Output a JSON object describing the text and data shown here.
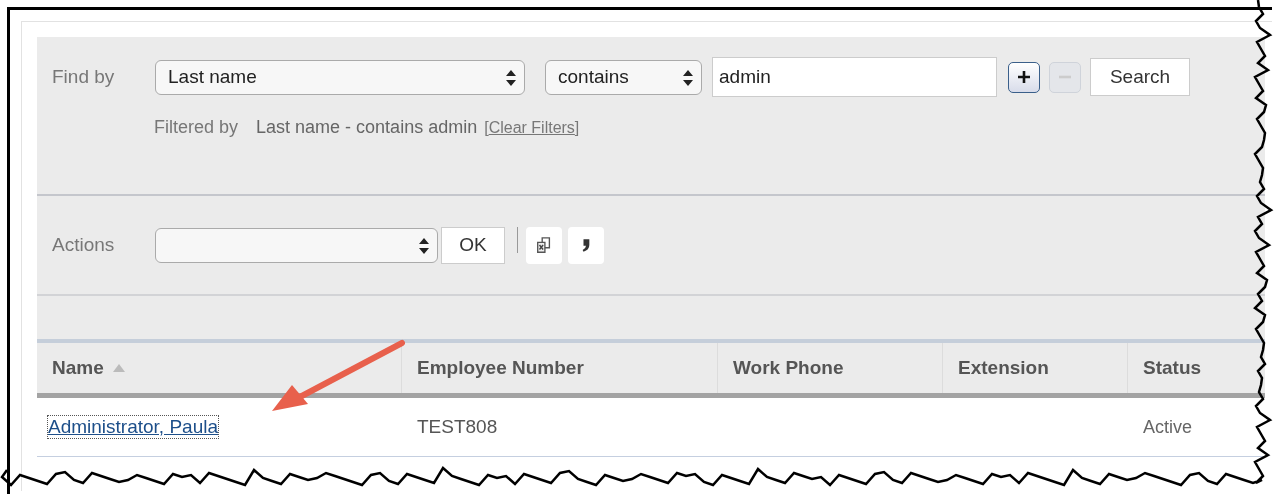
{
  "search": {
    "label": "Find by",
    "field_select": {
      "value": "Last name"
    },
    "operator_select": {
      "value": "contains"
    },
    "query": {
      "value": "admin"
    },
    "filter_buttons": [
      {
        "kind": "add",
        "disabled": false
      },
      {
        "kind": "remove",
        "disabled": true
      }
    ],
    "search_button": "Search",
    "filter_summary": {
      "label": "Filtered by",
      "text": "Last name - contains admin",
      "clear_before": "[",
      "clear_link": "Clear Filters",
      "clear_after": "]"
    }
  },
  "actions": {
    "label": "Actions",
    "ok_button": "OK",
    "tools": [
      {
        "kind": "export"
      },
      {
        "kind": "quote"
      }
    ]
  },
  "table": {
    "columns": [
      {
        "label": "Name",
        "sorted": true
      },
      {
        "label": "Employee Number",
        "sorted": false
      },
      {
        "label": "Work Phone",
        "sorted": false
      },
      {
        "label": "Extension",
        "sorted": false
      },
      {
        "label": "Status",
        "sorted": false
      }
    ],
    "rows": [
      {
        "name": "Administrator, Paula",
        "employee_number": "TEST808",
        "status": "Active"
      }
    ]
  }
}
